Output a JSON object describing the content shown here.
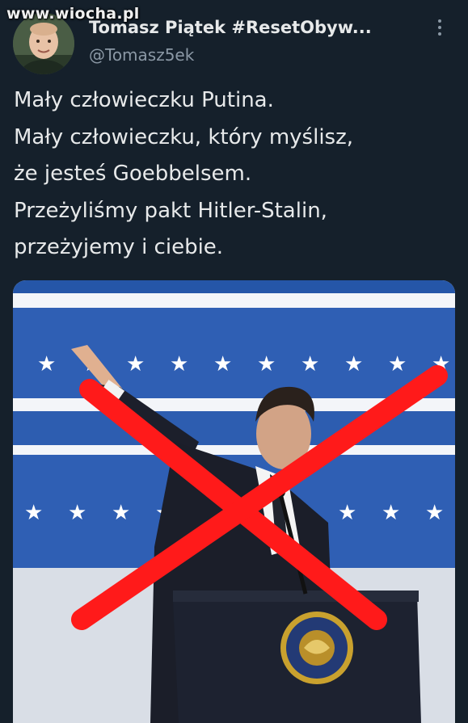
{
  "watermark": {
    "text": "www.wiocha.pl"
  },
  "author": {
    "display_name": "Tomasz Piątek #ResetObyw...",
    "handle": "@Tomasz5ek"
  },
  "tweet": {
    "lines": [
      "Mały człowieczku Putina.",
      "Mały człowieczku, który myślisz,",
      "że jesteś Goebbelsem.",
      "Przeżyliśmy pakt Hitler-Stalin,",
      "przeżyjemy i ciebie."
    ]
  },
  "media": {
    "description_icon": "photo",
    "cross_color": "#ff1a1a",
    "banner_color": "#2f5fb4"
  },
  "icons": {
    "more": "more-vertical-icon"
  }
}
